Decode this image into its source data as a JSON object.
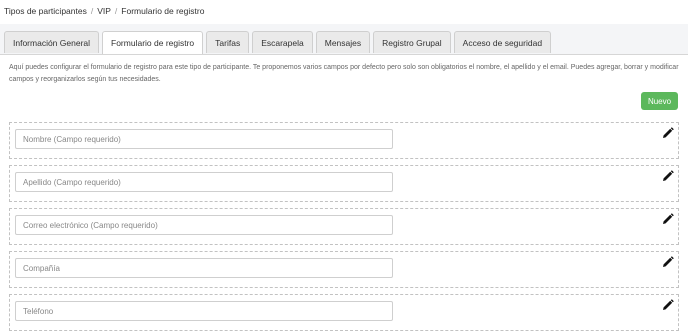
{
  "breadcrumb": {
    "items": [
      "Tipos de participantes",
      "VIP",
      "Formulario de registro"
    ],
    "separator": "/"
  },
  "tabs": [
    {
      "label": "Información General",
      "active": false
    },
    {
      "label": "Formulario de registro",
      "active": true
    },
    {
      "label": "Tarifas",
      "active": false
    },
    {
      "label": "Escarapela",
      "active": false
    },
    {
      "label": "Mensajes",
      "active": false
    },
    {
      "label": "Registro Grupal",
      "active": false
    },
    {
      "label": "Acceso de seguridad",
      "active": false
    }
  ],
  "main": {
    "description": "Aquí puedes configurar el formulario de registro para este tipo de participante. Te proponemos varios campos por defecto pero solo son obligatorios el nombre, el apellido y el email. Puedes agregar, borrar y modificar campos y reorganizarlos según tus necesidades.",
    "new_button_label": "Nuevo",
    "fields": [
      {
        "placeholder": "Nombre (Campo requerido)",
        "icon": "pencil-icon"
      },
      {
        "placeholder": "Apellido (Campo requerido)",
        "icon": "pencil-icon"
      },
      {
        "placeholder": "Correo electrónico (Campo requerido)",
        "icon": "pencil-icon"
      },
      {
        "placeholder": "Compañía",
        "icon": "pencil-icon"
      },
      {
        "placeholder": "Teléfono",
        "icon": "pencil-icon"
      }
    ]
  },
  "colors": {
    "primary_button": "#5cb85c",
    "panel_background": "#f4f5f7"
  }
}
